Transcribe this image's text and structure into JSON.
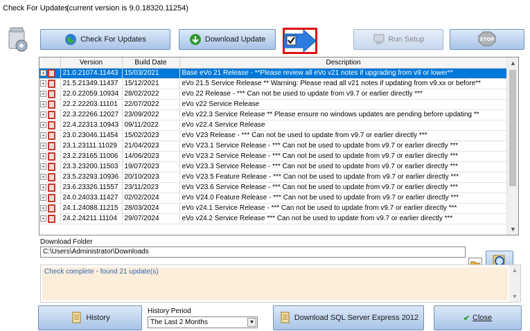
{
  "window": {
    "title": "Check For Updates",
    "version_text": "(current version is 9.0.18320.11254)"
  },
  "toolbar": {
    "check_updates": "Check For Updates",
    "download_update": "Download Update",
    "run_setup": "Run Setup",
    "stop_icon_text": "STOP"
  },
  "table": {
    "columns": [
      "Version",
      "Build Date",
      "Description"
    ],
    "rows": [
      {
        "version": "21.0.21074.11443",
        "date": "15/03/2021",
        "desc": "Base eVo 21 Release - **Please review all eVo v21 notes if upgrading from v9 or lower**"
      },
      {
        "version": "21.5.21349.11437",
        "date": "15/12/2021",
        "desc": "eVo 21.5 Service Release ** Warning: Please read all v21 notes if updating from v9.xx or before**"
      },
      {
        "version": "22.0.22059.10934",
        "date": "28/02/2022",
        "desc": "eVo 22 Release - *** Can not be used to update from v9.7 or earlier directly ***"
      },
      {
        "version": "22.2.22203.11101",
        "date": "22/07/2022",
        "desc": "eVo v22 Service Release"
      },
      {
        "version": "22.3.22266.12027",
        "date": "23/09/2022",
        "desc": "eVo v22.3 Service Release ** Please ensure no windows updates are pending before updating **"
      },
      {
        "version": "22.4.22313.10943",
        "date": "09/11/2022",
        "desc": "eVo v22.4 Service Release"
      },
      {
        "version": "23.0.23046.11454",
        "date": "15/02/2023",
        "desc": "eVo V23 Release - *** Can not be used to update from v9.7 or earlier directly ***"
      },
      {
        "version": "23.1.23111.11029",
        "date": "21/04/2023",
        "desc": "eVo V23.1 Service Release - *** Can not be used to update from v9.7 or earlier directly ***"
      },
      {
        "version": "23.2.23165.11006",
        "date": "14/06/2023",
        "desc": "eVo V23.2 Service Release - *** Can not be used to update from v9.7 or earlier directly ***"
      },
      {
        "version": "23.3.23200.11503",
        "date": "19/07/2023",
        "desc": "eVo V23.3 Service Release - *** Can not be used to update from v9.7 or earlier directly ***"
      },
      {
        "version": "23.5.23293.10936",
        "date": "20/10/2023",
        "desc": "eVo V23.5 Feature Release - *** Can not be used to update from v9.7 or earlier directly ***"
      },
      {
        "version": "23.6.23326.11557",
        "date": "23/11/2023",
        "desc": "eVo V23.6 Service Release - *** Can not be used to update from v9.7 or earlier directly ***"
      },
      {
        "version": "24.0.24033.11427",
        "date": "02/02/2024",
        "desc": "eVo V24.0 Feature Release - *** Can not be used to update from v9.7 or earlier directly ***"
      },
      {
        "version": "24.1.24088.11215",
        "date": "28/03/2024",
        "desc": "eVo v24.1 Service Release - *** Can not be used to update from v9.7 or earlier directly ***"
      },
      {
        "version": "24.2.24211.11104",
        "date": "29/07/2024",
        "desc": "eVo v24.2 Service Release *** Can not be used to update from v9.7 or earlier directly ***"
      }
    ],
    "selected_row": 0
  },
  "download_folder": {
    "label": "Download Folder",
    "path": "C:\\Users\\Administrator\\Downloads"
  },
  "status": {
    "message": "Check complete - found 21 update(s)"
  },
  "bottom": {
    "history": "History",
    "history_period_label": "History Period",
    "history_period_value": "The Last 2 Months",
    "sql_download": "Download SQL Server Express 2012",
    "close": "Close"
  },
  "colors": {
    "selection": "#0078d7",
    "highlight_border": "#e01010",
    "status_bg": "#fbeedb"
  }
}
